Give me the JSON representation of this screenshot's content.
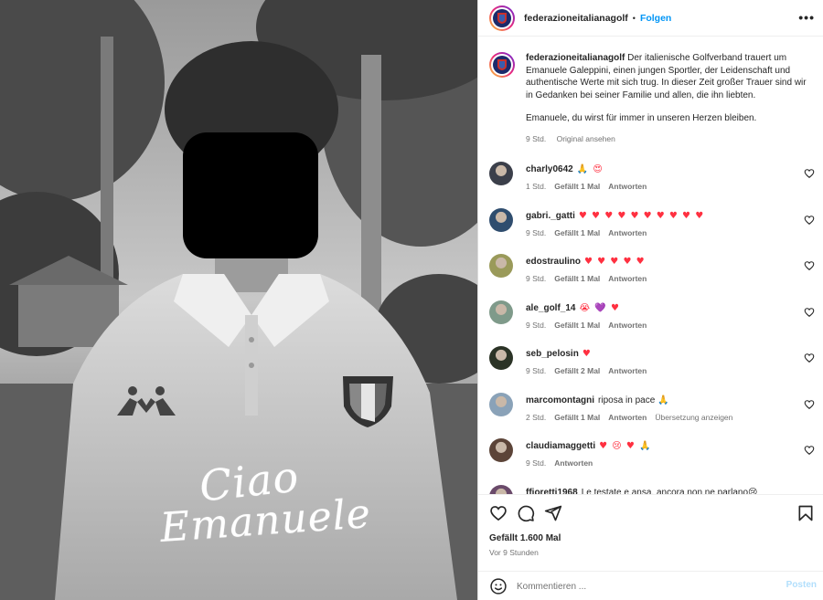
{
  "photo": {
    "caption_line1": "Ciao",
    "caption_line2": "Emanuele"
  },
  "header": {
    "username": "federazioneitalianagolf",
    "separator": "•",
    "follow_label": "Folgen",
    "more_icon": "•••"
  },
  "caption": {
    "username": "federazioneitalianagolf",
    "paragraph1": "Der italienische Golfverband trauert um Emanuele Galeppini, einen jungen Sportler, der Leidenschaft und authentische Werte mit sich trug. In dieser Zeit großer Trauer sind wir in Gedanken bei seiner Familie und allen, die ihn liebten.",
    "paragraph2": "Emanuele, du wirst für immer in unseren Herzen bleiben.",
    "time": "9 Std.",
    "see_original": "Original ansehen"
  },
  "comments": [
    {
      "username": "charly0642",
      "text": "",
      "emoji": "🙏 😍",
      "time": "1 Std.",
      "likes": "Gefällt 1 Mal",
      "reply": "Antworten",
      "extra": "",
      "avatar_color": "#3b3f4a"
    },
    {
      "username": "gabri._gatti",
      "text": "",
      "emoji": "♥ ♥ ♥ ♥ ♥ ♥ ♥ ♥ ♥ ♥",
      "time": "9 Std.",
      "likes": "Gefällt 1 Mal",
      "reply": "Antworten",
      "extra": "",
      "avatar_color": "#2f4d6e"
    },
    {
      "username": "edostraulino",
      "text": "",
      "emoji": "♥ ♥ ♥ ♥ ♥",
      "time": "9 Std.",
      "likes": "Gefällt 1 Mal",
      "reply": "Antworten",
      "extra": "",
      "avatar_color": "#9a9a5a"
    },
    {
      "username": "ale_golf_14",
      "text": "",
      "emoji": "😭 💜 ♥",
      "time": "9 Std.",
      "likes": "Gefällt 1 Mal",
      "reply": "Antworten",
      "extra": "",
      "avatar_color": "#7f9a8a"
    },
    {
      "username": "seb_pelosin",
      "text": "",
      "emoji": "♥",
      "time": "9 Std.",
      "likes": "Gefällt 2 Mal",
      "reply": "Antworten",
      "extra": "",
      "avatar_color": "#2b3326"
    },
    {
      "username": "marcomontagni",
      "text": "riposa in pace",
      "emoji": "🙏",
      "time": "2 Std.",
      "likes": "Gefällt 1 Mal",
      "reply": "Antworten",
      "extra": "Übersetzung anzeigen",
      "avatar_color": "#8aa2b8"
    },
    {
      "username": "claudiamaggetti",
      "text": "",
      "emoji": "♥ 😢 ♥ 🙏",
      "time": "9 Std.",
      "likes": "",
      "reply": "Antworten",
      "extra": "",
      "avatar_color": "#5c4438"
    },
    {
      "username": "ffioretti1968",
      "text": "Le testate e ansa. ancora non ne parlano😢",
      "emoji": "",
      "time": "",
      "likes": "",
      "reply": "",
      "extra": "",
      "avatar_color": "#6a4a6a"
    }
  ],
  "footer": {
    "likes": "Gefällt 1.600 Mal",
    "time_ago": "Vor 9 Stunden",
    "comment_placeholder": "Kommentieren ...",
    "post_label": "Posten"
  },
  "colors": {
    "accent": "#0095f6",
    "heart": "#ff3040",
    "muted": "#737373"
  }
}
